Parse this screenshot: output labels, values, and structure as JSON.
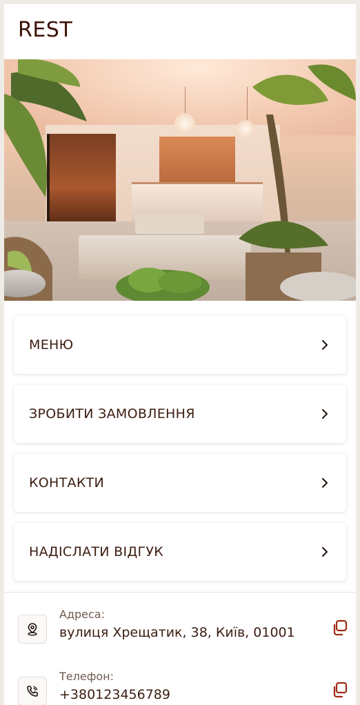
{
  "header": {
    "logo": "REST"
  },
  "hero": {
    "image_alt": "Restaurant interior photo"
  },
  "menu": {
    "items": [
      {
        "label": "МЕНЮ"
      },
      {
        "label": "ЗРОБИТИ ЗАМОВЛЕННЯ"
      },
      {
        "label": "КОНТАКТИ"
      },
      {
        "label": "НАДІСЛАТИ ВІДГУК"
      }
    ]
  },
  "info": {
    "address": {
      "label": "Адреса:",
      "value": "вулиця Хрещатик, 38, Київ, 01001",
      "icon": "location-pin-icon"
    },
    "phone": {
      "label": "Телефон:",
      "value": "+380123456789",
      "icon": "phone-icon"
    }
  },
  "colors": {
    "text": "#3a1c10",
    "accent": "#9c2a12",
    "page_bg": "#efece8"
  }
}
